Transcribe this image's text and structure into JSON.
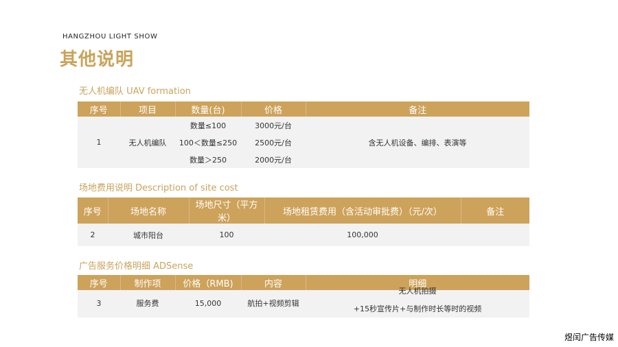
{
  "brand": "HANGZHOU LIGHT SHOW",
  "title": "其他说明",
  "watermark": "煜闰广告传媒",
  "sections": {
    "uav": {
      "title": "无人机编队 UAV formation",
      "headers": [
        "序号",
        "项目",
        "数量(台)",
        "价格",
        "备注"
      ],
      "row": {
        "no": "1",
        "item": "无人机编队",
        "tiers": [
          {
            "qty": "数量≤100",
            "price": "3000元/台"
          },
          {
            "qty": "100＜数量≤250",
            "price": "2500元/台"
          },
          {
            "qty": "数量＞250",
            "price": "2000元/台"
          }
        ],
        "note": "含无人机设备、编排、表演等"
      }
    },
    "site": {
      "title": "场地费用说明 Description of site cost",
      "headers": [
        "序号",
        "场地名称",
        "场地尺寸（平方米）",
        "场地租赁费用（含活动审批费）（元/次）",
        "备注"
      ],
      "row": {
        "no": "2",
        "name": "城市阳台",
        "size": "100",
        "fee": "100,000",
        "note": ""
      }
    },
    "ads": {
      "title": "广告服务价格明细 ADSense",
      "headers": [
        "序号",
        "制作项",
        "价格（RMB)",
        "内容",
        "明细"
      ],
      "row": {
        "no": "3",
        "item": "服务费",
        "price": "15,000",
        "content": "航拍+视频剪辑",
        "detail_line1": "无人机拍摄",
        "detail_line2": "+15秒宣传片+与制作时长等时的视频"
      }
    }
  }
}
